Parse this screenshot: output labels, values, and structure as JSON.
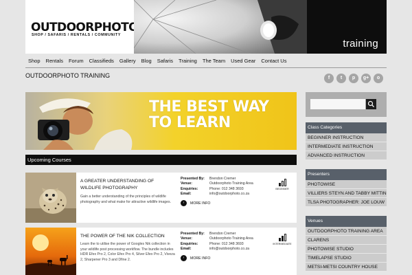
{
  "header": {
    "logo": "OUTDOORPHOTO",
    "logo_tagline": "SHOP / SAFARIS / RENTALS / COMMUNITY",
    "section_title": "training"
  },
  "nav": {
    "items": [
      "Shop",
      "Rentals",
      "Forum",
      "Classifieds",
      "Gallery",
      "Blog",
      "Safaris",
      "Training",
      "The Team",
      "Used Gear",
      "Contact Us"
    ]
  },
  "page": {
    "heading": "OUTDOORPHOTO TRAINING"
  },
  "social": {
    "icons": [
      "f",
      "t",
      "p",
      "g+",
      "o"
    ]
  },
  "banner": {
    "line1": "THE BEST WAY",
    "line2": "TO LEARN"
  },
  "courses_section": {
    "title": "Upcoming Courses"
  },
  "courses": [
    {
      "title": "A GREATER UNDERSTANDING OF WILDLIFE PHOTOGRAPHY",
      "description": "Gain a better understanding of the principles of wildlife photography and what make for attractive wildlife images.",
      "presented_by_label": "Presented By:",
      "presented_by": "Brendon Cremer",
      "venue_label": "Venue:",
      "venue": "Outdoorphoto Training Area",
      "enquiries_label": "Enquiries:",
      "enquiries": "Phone: 012 348 3693",
      "email_label": "Email:",
      "email": "info@outdoorphoto.co.za",
      "more_label": "MORE INFO",
      "level": "BEGINNER",
      "level_value": 1
    },
    {
      "title": "THE POWER OF THE NIK COLLECTION",
      "description": "Learn the to utilise the power of Googles Nik collection in your wildlife post processing workflow. The bundle includes HDR Efex Pro 2, Color Efex Pro 4, Silver Efex Pro 2, Viveza 2, Sharpener Pro 3 and Dfine 2.",
      "presented_by_label": "Presented By:",
      "presented_by": "Brendon Cremer",
      "venue_label": "Venue:",
      "venue": "Outdoorphoto Training Area",
      "enquiries_label": "Enquiries:",
      "enquiries": "Phone: 012 348 3693",
      "email_label": "Email:",
      "email": "info@outdoorphoto.co.za",
      "more_label": "MORE INFO",
      "level": "INTERMEDIATE",
      "level_value": 2
    }
  ],
  "sidebar": {
    "class_categories": {
      "title": "Class Categories",
      "items": [
        "BEGINNER INSTRUCTION",
        "INTERMEDIATE INSTRUCTION",
        "ADVANCED INSTRUCTION"
      ]
    },
    "presenters": {
      "title": "Presenters",
      "items": [
        "PHOTOWISE",
        "VILLIERS STEYN AND TABBY MITTINS",
        "TLSA PHOTOGRAPHER: JOE LOUW"
      ]
    },
    "venues": {
      "title": "Venues",
      "items": [
        "OUTDOORPHOTO TRAINING AREA",
        "CLARENS",
        "PHOTOWISE STUDIO",
        "TIMELAPSE STUDIO",
        "METSI-METSI COUNTRY HOUSE"
      ]
    }
  },
  "colors": {
    "banner_yellow": "#f2cd1a",
    "sidebar_header": "#58606a",
    "sidebar_item": "#cccccc",
    "page_bg": "#e6e6e6"
  }
}
